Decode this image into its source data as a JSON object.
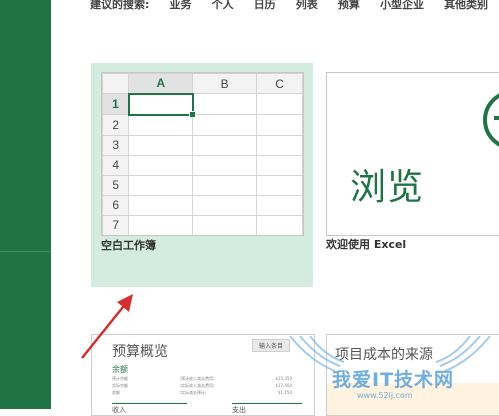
{
  "suggested_searches": {
    "label": "建议的搜索:",
    "items": [
      "业务",
      "个人",
      "日历",
      "列表",
      "预算",
      "小型企业",
      "其他类别"
    ]
  },
  "blank_workbook": {
    "label": "空白工作簿",
    "columns": [
      "A",
      "B",
      "C"
    ],
    "rows": [
      "1",
      "2",
      "3",
      "4",
      "5",
      "6",
      "7"
    ]
  },
  "welcome_tile": {
    "preview_text": "浏览",
    "label": "欢迎使用 Excel"
  },
  "budget_template": {
    "title": "预算概览",
    "button": "输入条目",
    "balance_title": "余额",
    "lines": [
      {
        "name": "预计余额",
        "note": "（预计收入减去费用）",
        "value": "$15,350"
      },
      {
        "name": "实际余额",
        "note": "（实际收入减去费用）",
        "value": "$17,400"
      },
      {
        "name": "差额",
        "note": "（实际减去预计）",
        "value": "$1,150"
      }
    ],
    "income": "收入",
    "expense": "支出"
  },
  "project_template": {
    "title": "项目成本的来源"
  },
  "watermark": {
    "text": "我爱IT技术网",
    "url": "www.52ij.com"
  },
  "colors": {
    "excel_green": "#217346",
    "selection_bg": "#d3ecdf",
    "arrow": "#d32f2f",
    "watermark": "#5aa0d8"
  }
}
